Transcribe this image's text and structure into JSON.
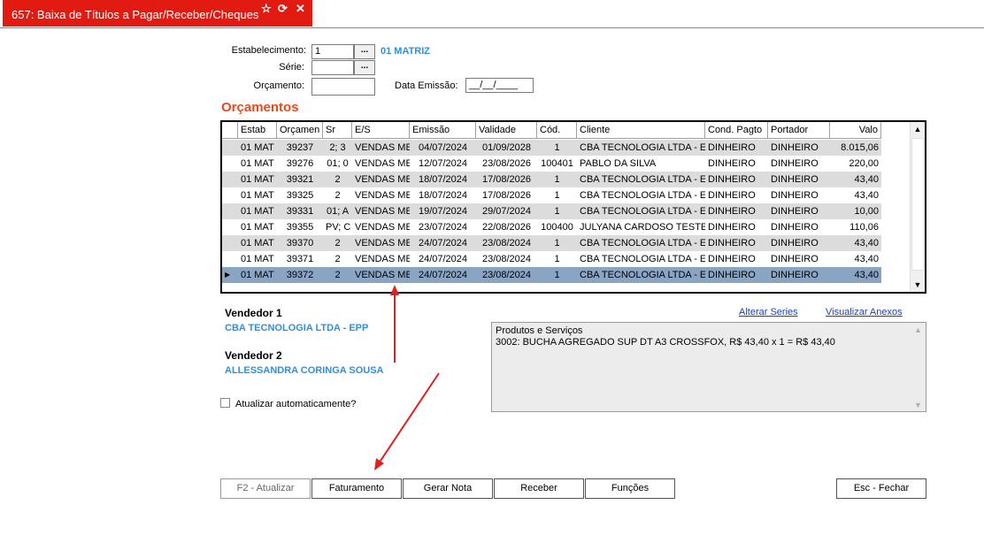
{
  "window": {
    "title": "657: Baixa de Títulos a Pagar/Receber/Cheques",
    "icons": [
      "star-icon",
      "refresh-icon",
      "close-icon"
    ]
  },
  "form": {
    "estabelecimento_label": "Estabelecimento:",
    "estabelecimento_value": "1",
    "estabelecimento_name": "01 MATRIZ",
    "serie_label": "Série:",
    "serie_value": "",
    "orcamento_label": "Orçamento:",
    "orcamento_value": "",
    "data_emissao_label": "Data Emissão:",
    "data_emissao_value": "__/__/____",
    "lookup_button": "..."
  },
  "grid": {
    "heading": "Orçamentos",
    "columns": [
      "Estab",
      "Orçamen",
      "Sr",
      "E/S",
      "Emissão",
      "Validade",
      "Cód.",
      "Cliente",
      "Cond. Pagto",
      "Portador",
      "Valo"
    ],
    "rows": [
      [
        "01 MAT",
        "39237",
        "2; 3",
        "VENDAS ME",
        "04/07/2024",
        "01/09/2028",
        "1",
        "CBA TECNOLOGIA LTDA - E",
        "DINHEIRO",
        "DINHEIRO",
        "8.015,06"
      ],
      [
        "01 MAT",
        "39276",
        "01; 0",
        "VENDAS ME",
        "12/07/2024",
        "23/08/2026",
        "100401",
        "PABLO DA SILVA",
        "DINHEIRO",
        "DINHEIRO",
        "220,00"
      ],
      [
        "01 MAT",
        "39321",
        "2",
        "VENDAS ME",
        "18/07/2024",
        "17/08/2026",
        "1",
        "CBA TECNOLOGIA LTDA - E",
        "DINHEIRO",
        "DINHEIRO",
        "43,40"
      ],
      [
        "01 MAT",
        "39325",
        "2",
        "VENDAS ME",
        "18/07/2024",
        "17/08/2026",
        "1",
        "CBA TECNOLOGIA LTDA - E",
        "DINHEIRO",
        "DINHEIRO",
        "43,40"
      ],
      [
        "01 MAT",
        "39331",
        "01; A",
        "VENDAS ME",
        "19/07/2024",
        "29/07/2024",
        "1",
        "CBA TECNOLOGIA LTDA - E",
        "DINHEIRO",
        "DINHEIRO",
        "10,00"
      ],
      [
        "01 MAT",
        "39355",
        "PV; C",
        "VENDAS ME",
        "23/07/2024",
        "22/08/2026",
        "100400",
        "JULYANA CARDOSO TESTE",
        "DINHEIRO",
        "DINHEIRO",
        "110,06"
      ],
      [
        "01 MAT",
        "39370",
        "2",
        "VENDAS ME",
        "24/07/2024",
        "23/08/2024",
        "1",
        "CBA TECNOLOGIA LTDA - E",
        "DINHEIRO",
        "DINHEIRO",
        "43,40"
      ],
      [
        "01 MAT",
        "39371",
        "2",
        "VENDAS ME",
        "24/07/2024",
        "23/08/2024",
        "1",
        "CBA TECNOLOGIA LTDA - E",
        "DINHEIRO",
        "DINHEIRO",
        "43,40"
      ],
      [
        "01 MAT",
        "39372",
        "2",
        "VENDAS ME",
        "24/07/2024",
        "23/08/2024",
        "1",
        "CBA TECNOLOGIA LTDA - E",
        "DINHEIRO",
        "DINHEIRO",
        "43,40"
      ]
    ],
    "selected_row": 8
  },
  "details": {
    "vendedor1_label": "Vendedor 1",
    "vendedor1_value": "CBA TECNOLOGIA LTDA - EPP",
    "vendedor2_label": "Vendedor 2",
    "vendedor2_value": "ALLESSANDRA CORINGA SOUSA",
    "auto_update_label": "Atualizar automaticamente?",
    "alterar_series": "Alterar Series",
    "visualizar_anexos": "Visualizar Anexos",
    "produtos_title": "Produtos e Serviços",
    "produtos_line": "3002: BUCHA AGREGADO SUP DT A3 CROSSFOX, R$ 43,40 x 1 = R$ 43,40"
  },
  "buttons": {
    "atualizar": "F2 - Atualizar",
    "faturamento": "Faturamento",
    "gerar_nota": "Gerar Nota",
    "receber": "Receber",
    "funcoes": "Funções",
    "fechar": "Esc - Fechar"
  },
  "colors": {
    "title_bg": "#e11b12",
    "accent_blue": "#2f8fe0",
    "heading_orange": "#e8491d",
    "selected_row": "#8aa4c4",
    "annotation_arrow": "#e02020"
  }
}
